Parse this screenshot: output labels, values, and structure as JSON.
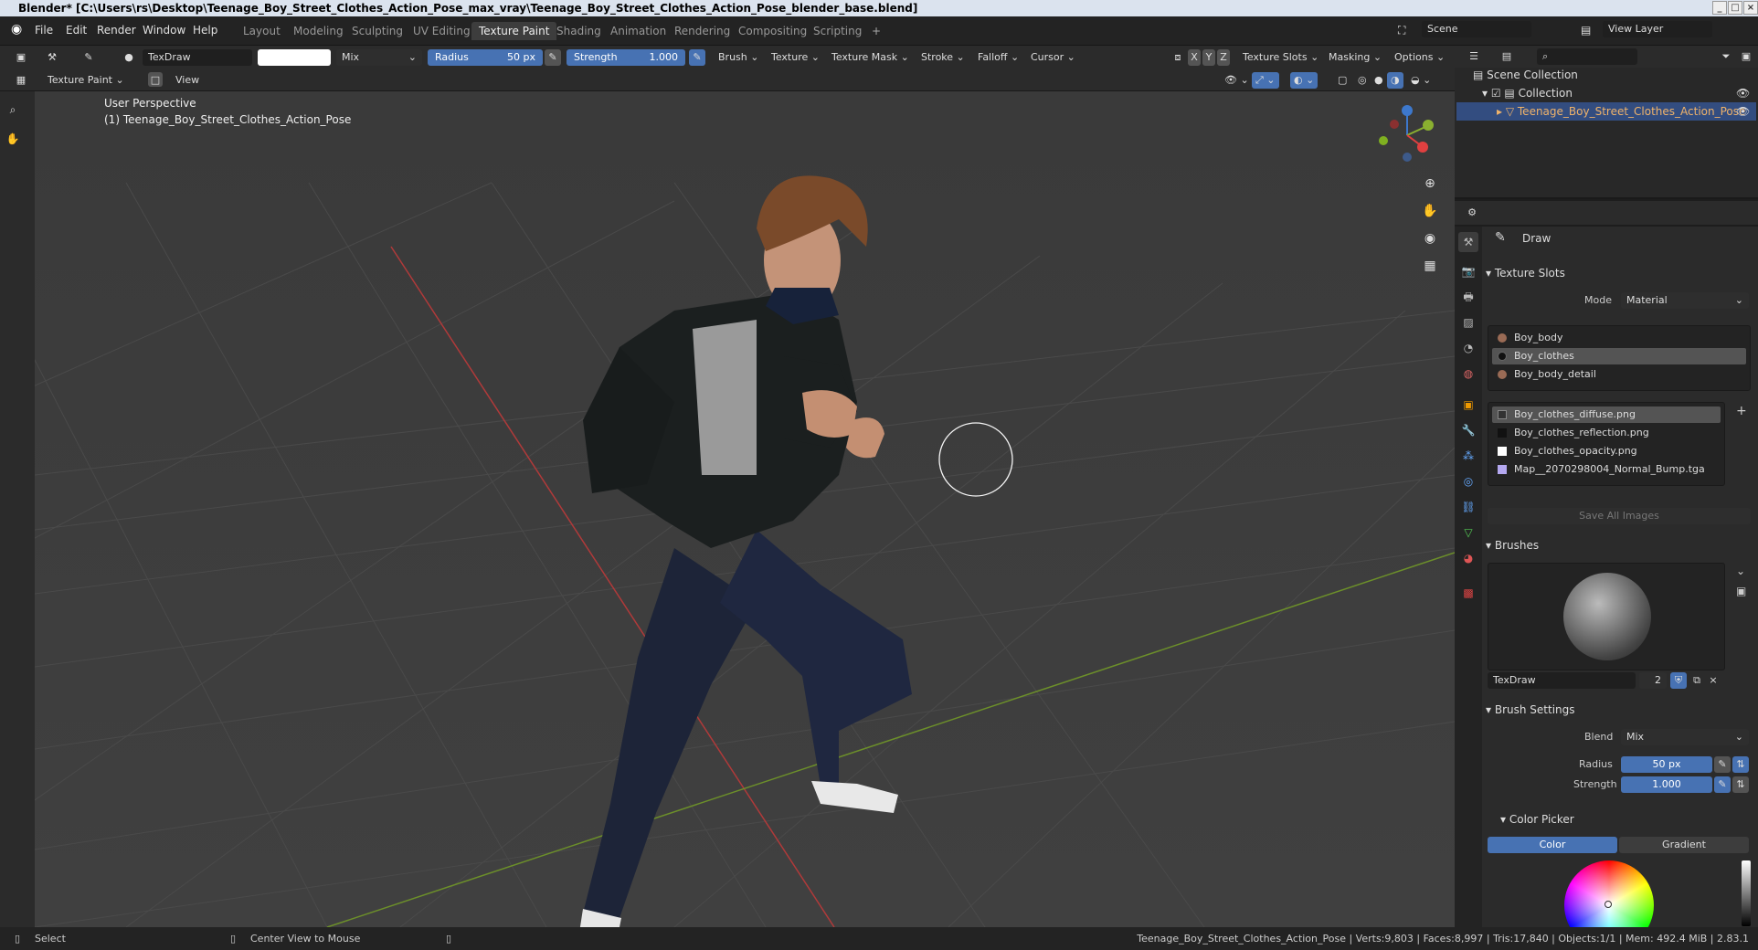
{
  "window": {
    "title": "Blender* [C:\\Users\\rs\\Desktop\\Teenage_Boy_Street_Clothes_Action_Pose_max_vray\\Teenage_Boy_Street_Clothes_Action_Pose_blender_base.blend]"
  },
  "menu": [
    "File",
    "Edit",
    "Render",
    "Window",
    "Help"
  ],
  "workspaces": [
    "Layout",
    "Modeling",
    "Sculpting",
    "UV Editing",
    "Texture Paint",
    "Shading",
    "Animation",
    "Rendering",
    "Compositing",
    "Scripting"
  ],
  "active_workspace": "Texture Paint",
  "scene": "Scene",
  "view_layer": "View Layer",
  "tool_header": {
    "brush_name": "TexDraw",
    "blend": "Mix",
    "radius_label": "Radius",
    "radius_value": "50 px",
    "strength_label": "Strength",
    "strength_value": "1.000",
    "menus": [
      "Brush",
      "Texture",
      "Texture Mask",
      "Stroke",
      "Falloff",
      "Cursor"
    ],
    "axes": [
      "X",
      "Y",
      "Z"
    ],
    "right_menus": [
      "Texture Slots",
      "Masking",
      "Options"
    ]
  },
  "editor_header": {
    "mode": "Texture Paint",
    "view": "View"
  },
  "viewport": {
    "perspective": "User Perspective",
    "object_label": "(1) Teenage_Boy_Street_Clothes_Action_Pose"
  },
  "outliner": {
    "scene_collection": "Scene Collection",
    "collection": "Collection",
    "object": "Teenage_Boy_Street_Clothes_Action_Pose"
  },
  "properties": {
    "tool": "Draw",
    "texture_slots_title": "Texture Slots",
    "mode_label": "Mode",
    "mode_value": "Material",
    "materials": [
      "Boy_body",
      "Boy_clothes",
      "Boy_body_detail"
    ],
    "selected_material": "Boy_clothes",
    "images": [
      "Boy_clothes_diffuse.png",
      "Boy_clothes_reflection.png",
      "Boy_clothes_opacity.png",
      "Map__2070298004_Normal_Bump.tga"
    ],
    "selected_image": "Boy_clothes_diffuse.png",
    "save_all": "Save All Images",
    "brushes_title": "Brushes",
    "brush_name": "TexDraw",
    "brush_users": "2",
    "brush_settings_title": "Brush Settings",
    "blend_label": "Blend",
    "blend_value": "Mix",
    "radius_label": "Radius",
    "radius_value": "50 px",
    "strength_label": "Strength",
    "strength_value": "1.000",
    "color_picker_title": "Color Picker",
    "color_tab": "Color",
    "gradient_tab": "Gradient"
  },
  "status": {
    "select": "Select",
    "center": "Center View to Mouse",
    "stats": "Teenage_Boy_Street_Clothes_Action_Pose | Verts:9,803 | Faces:8,997 | Tris:17,840 | Objects:1/1 | Mem: 492.4 MiB | 2.83.1"
  },
  "colors": {
    "accent": "#4772b3",
    "selected_row": "#334d80",
    "header": "#2b2b2b"
  }
}
